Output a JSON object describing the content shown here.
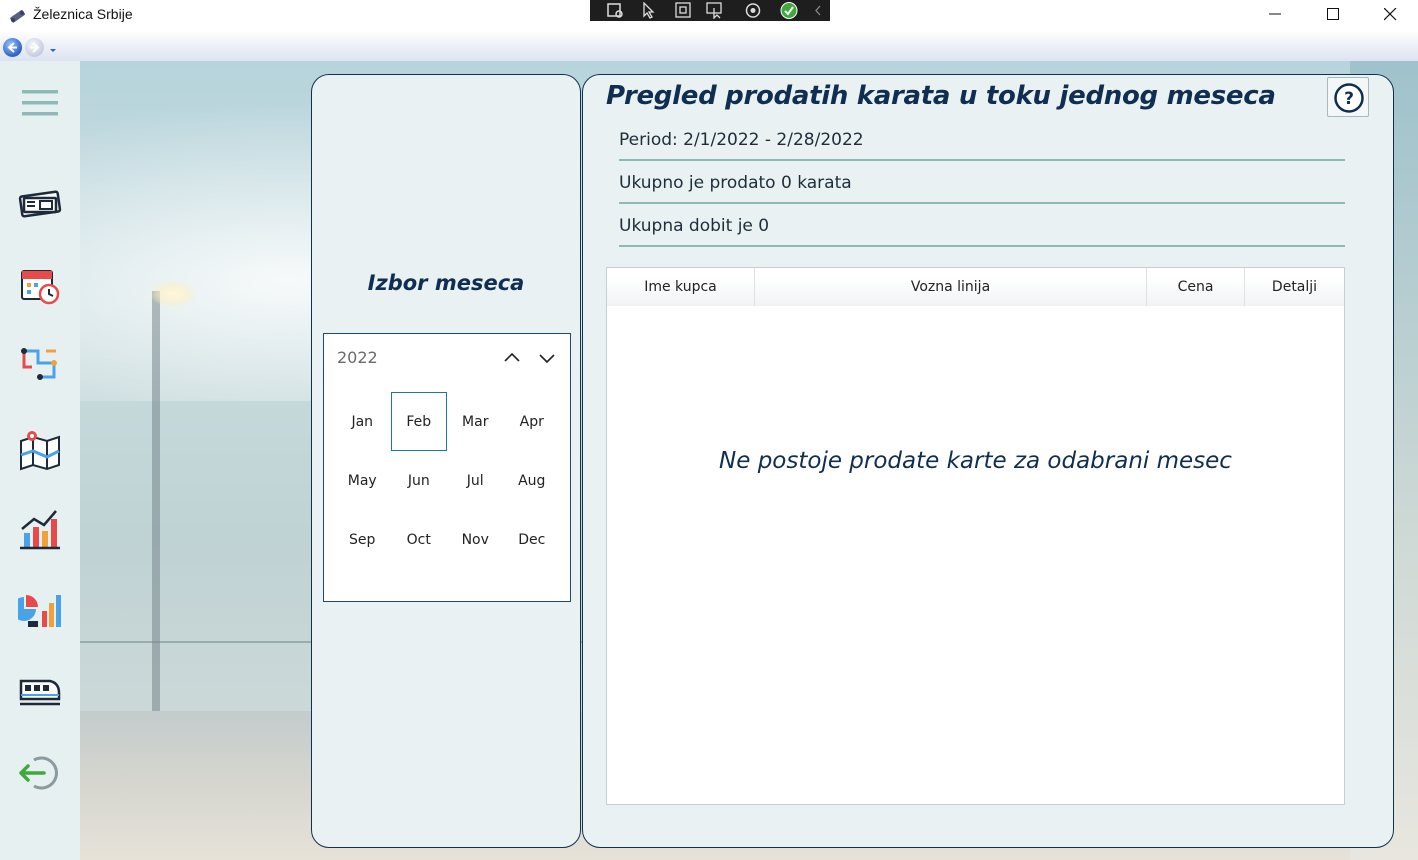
{
  "window": {
    "title": "Železnica Srbije"
  },
  "sidebar": {
    "items": [
      {
        "icon": "hamburger-menu-icon"
      },
      {
        "icon": "ticket-icon"
      },
      {
        "icon": "calendar-clock-icon"
      },
      {
        "icon": "route-icon"
      },
      {
        "icon": "map-icon"
      },
      {
        "icon": "growth-chart-icon"
      },
      {
        "icon": "analytics-chart-icon"
      },
      {
        "icon": "train-icon"
      },
      {
        "icon": "logout-icon"
      }
    ]
  },
  "month_picker": {
    "title": "Izbor meseca",
    "year": "2022",
    "months": [
      "Jan",
      "Feb",
      "Mar",
      "Apr",
      "May",
      "Jun",
      "Jul",
      "Aug",
      "Sep",
      "Oct",
      "Nov",
      "Dec"
    ],
    "selected": "Feb"
  },
  "report": {
    "title": "Pregled prodatih karata u toku jednog meseca",
    "period": "Period: 2/1/2022 - 2/28/2022",
    "total_sold": "Ukupno je prodato 0 karata",
    "total_profit": "Ukupna dobit je 0",
    "help_label": "?",
    "table": {
      "columns": [
        "Ime kupca",
        "Vozna linija",
        "Cena",
        "Detalji"
      ],
      "rows": [],
      "empty_message": "Ne postoje prodate karte za odabrani mesec"
    }
  },
  "colors": {
    "accent_dark": "#102e51",
    "panel_bg": "#e9f1f2",
    "divider": "#8fb9b7",
    "selection": "#1a73c2"
  }
}
